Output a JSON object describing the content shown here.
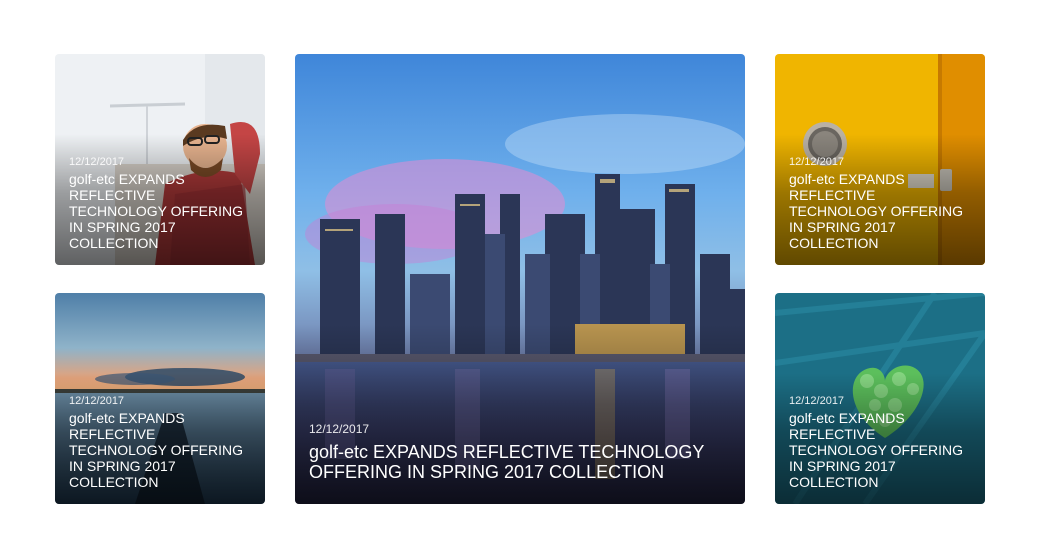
{
  "cards": [
    {
      "date": "12/12/2017",
      "title": "golf-etc EXPANDS REFLECTIVE TECHNOLOGY OFFERING IN SPRING 2017 COLLECTION",
      "image": "man-relaxing-at-desk"
    },
    {
      "date": "12/12/2017",
      "title": "golf-etc EXPANDS REFLECTIVE TECHNOLOGY OFFERING IN SPRING 2017 COLLECTION",
      "image": "sunset-lake-kayak"
    },
    {
      "date": "12/12/2017",
      "title": "golf-etc EXPANDS REFLECTIVE TECHNOLOGY OFFERING IN SPRING 2017 COLLECTION",
      "image": "city-skyline-at-dusk"
    },
    {
      "date": "12/12/2017",
      "title": "golf-etc EXPANDS REFLECTIVE TECHNOLOGY OFFERING IN SPRING 2017 COLLECTION",
      "image": "yellow-door-porthole"
    },
    {
      "date": "12/12/2017",
      "title": "golf-etc EXPANDS REFLECTIVE TECHNOLOGY OFFERING IN SPRING 2017 COLLECTION",
      "image": "green-leaf-heart-on-teal-fabric"
    }
  ]
}
